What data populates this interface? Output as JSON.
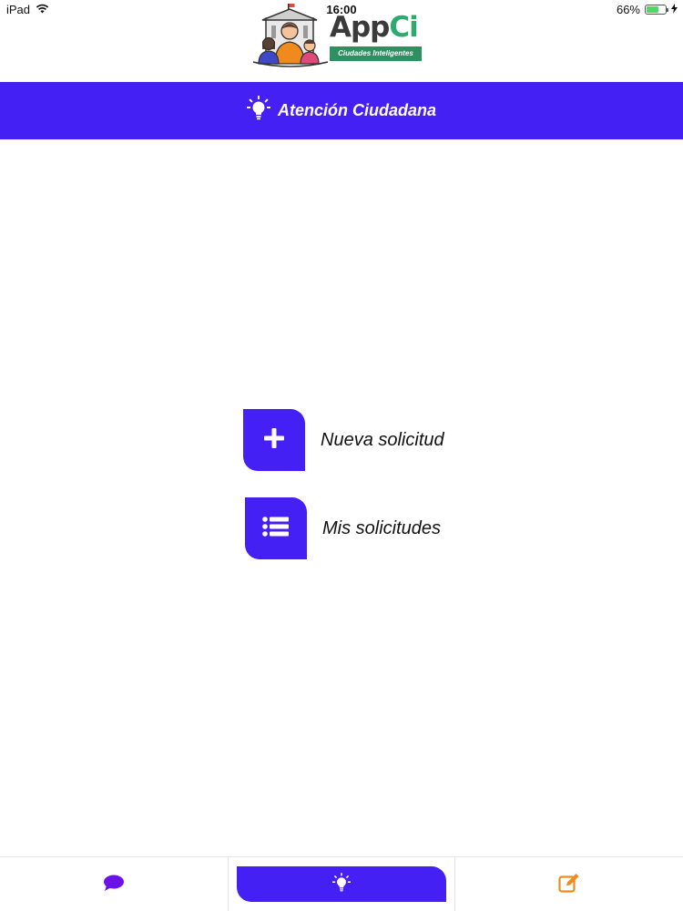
{
  "status_bar": {
    "device": "iPad",
    "time": "16:00",
    "battery": "66%",
    "battery_level": 0.66,
    "icons": [
      "wifi-icon",
      "battery-icon",
      "charging-icon"
    ]
  },
  "logo": {
    "app": "App",
    "ci": "Ci",
    "tagline": "Ciudades Inteligentes"
  },
  "header": {
    "title": "Atención Ciudadana",
    "icon": "lightbulb-icon"
  },
  "actions": [
    {
      "label": "Nueva solicitud",
      "icon": "plus-icon"
    },
    {
      "label": "Mis solicitudes",
      "icon": "list-icon"
    }
  ],
  "tabs": [
    {
      "icon": "chat-bubble-icon",
      "active": false,
      "color": "#6a12e8"
    },
    {
      "icon": "lightbulb-icon",
      "active": true,
      "color": "#ffffff"
    },
    {
      "icon": "edit-icon",
      "active": false,
      "color": "#f08a1c"
    }
  ],
  "colors": {
    "accent": "#4520f5",
    "brand_green": "#2e8f61"
  }
}
